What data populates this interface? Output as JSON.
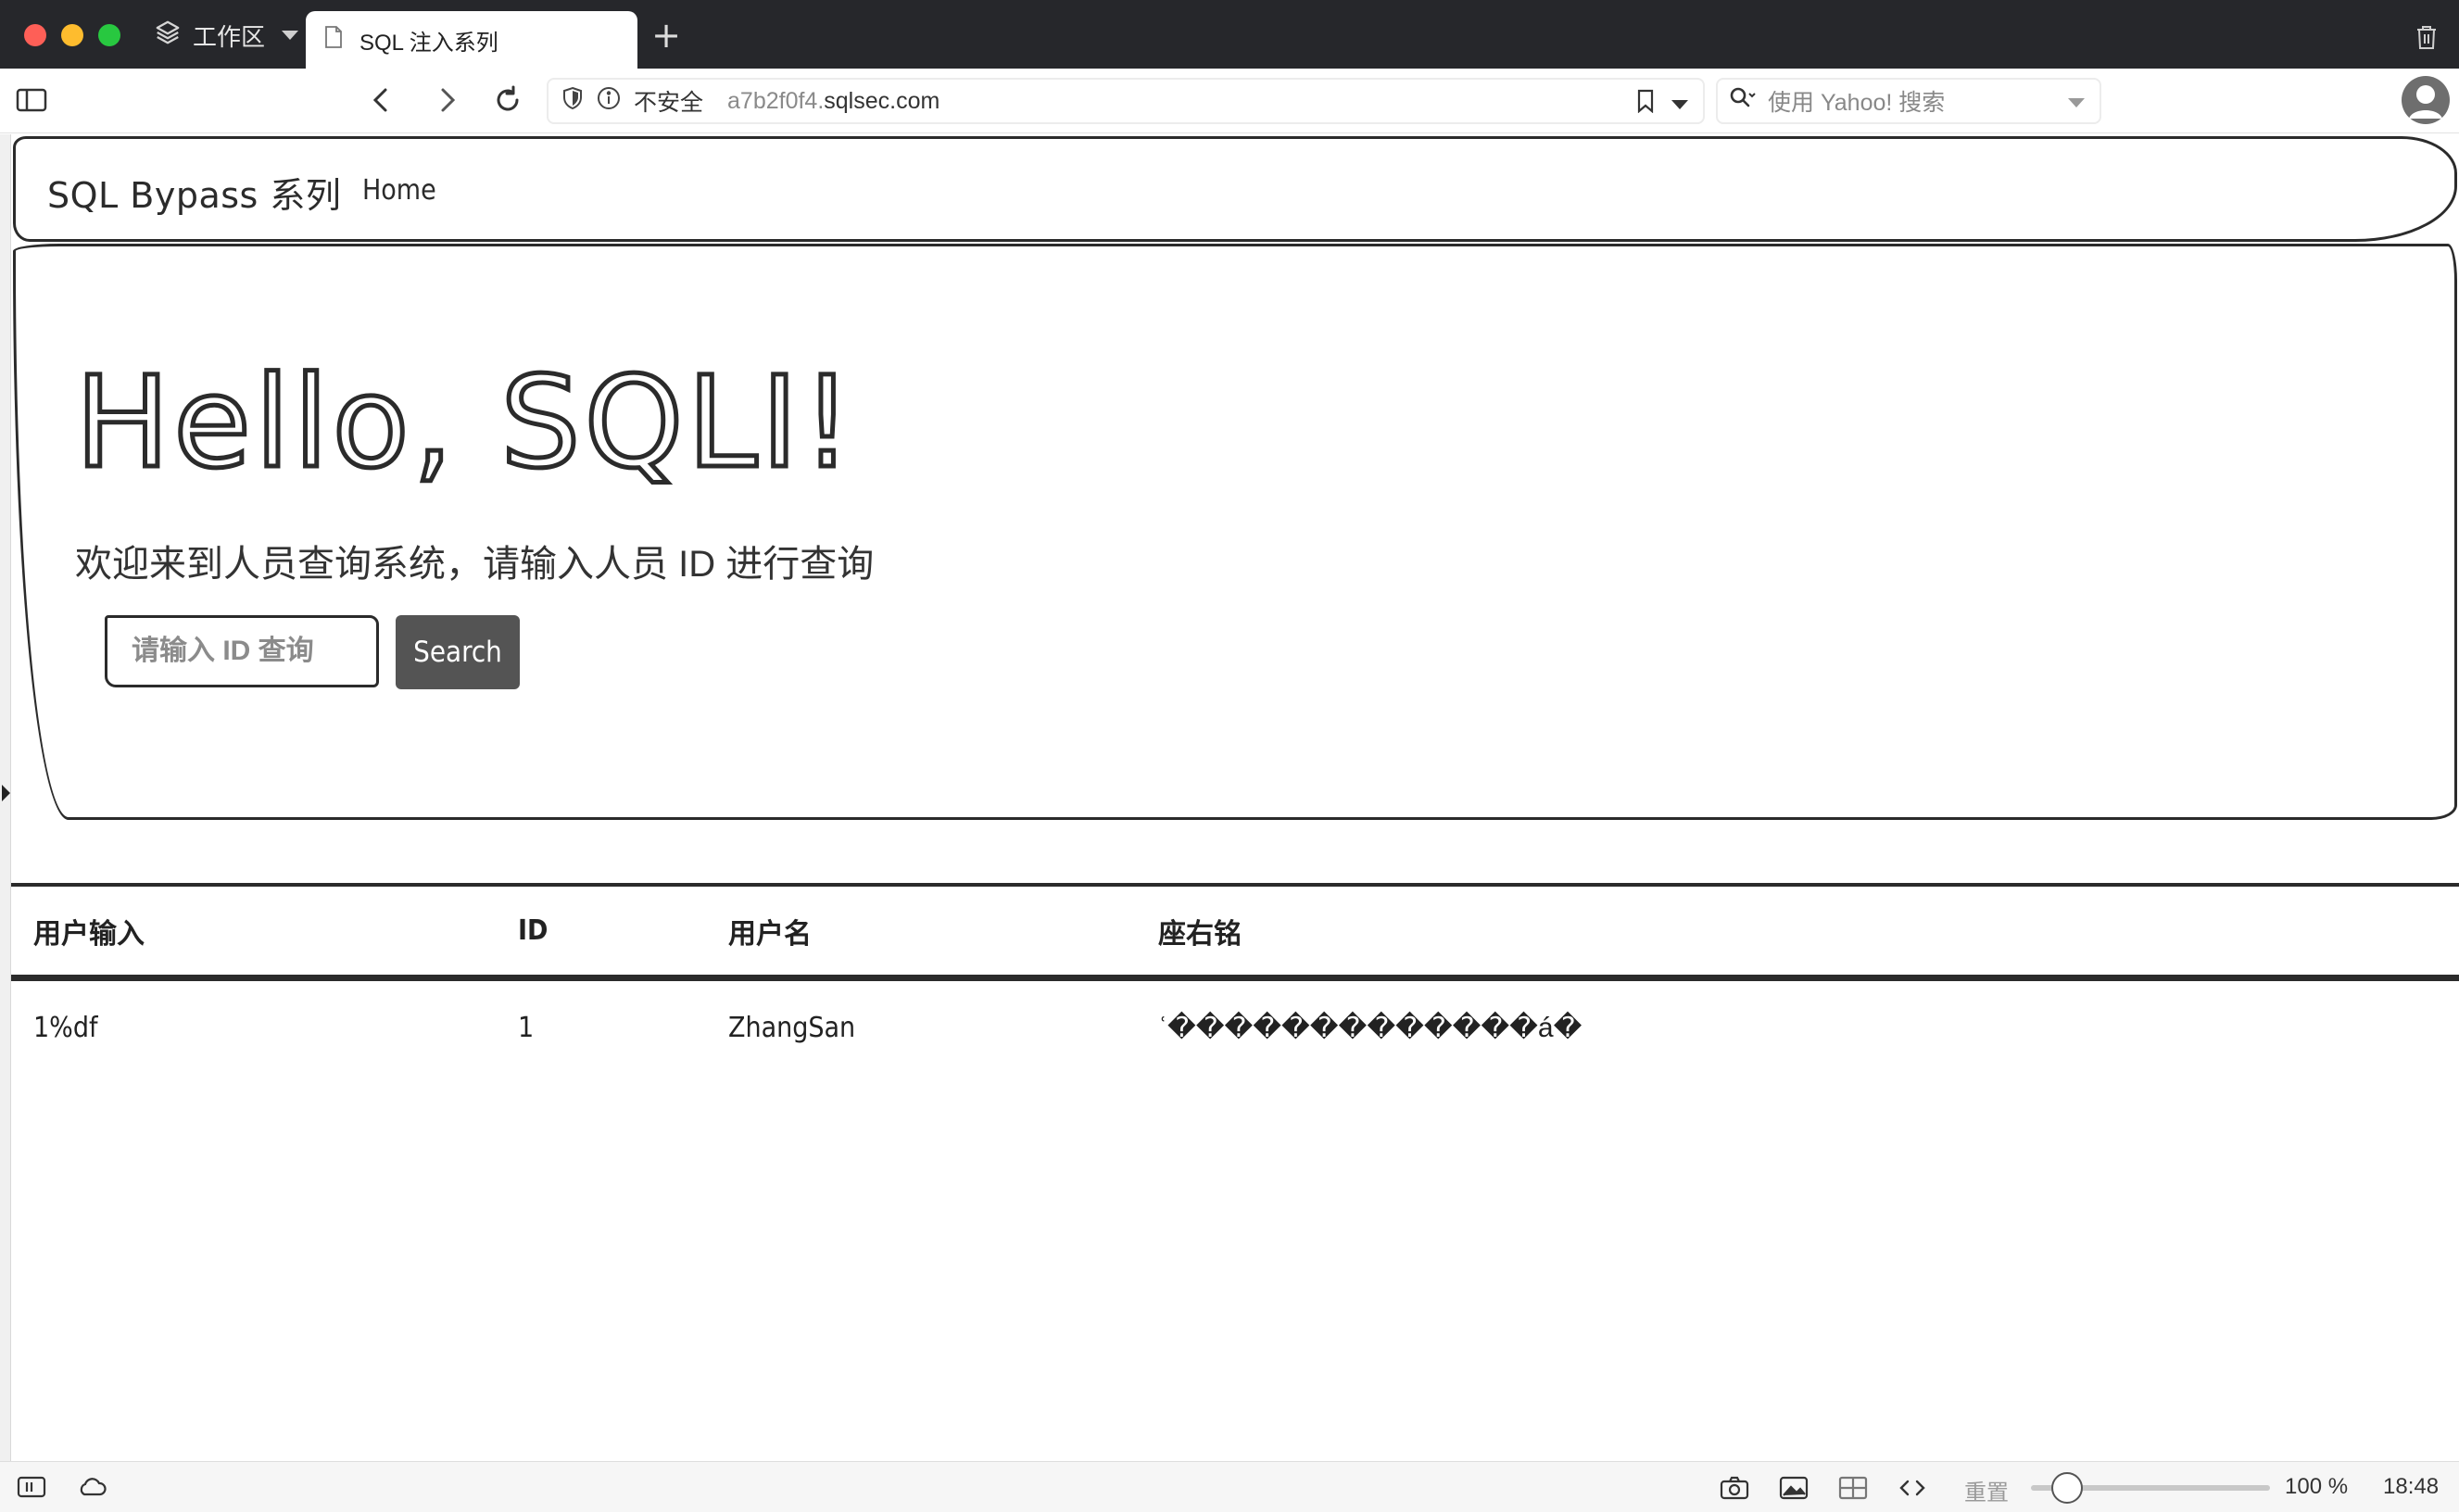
{
  "window": {
    "workspace_label": "工作区",
    "tab_title": "SQL 注入系列",
    "new_tab": "+"
  },
  "toolbar": {
    "security_label": "不安全",
    "url_subdomain": "a7b2f0f4.",
    "url_domain": "sqlsec.com",
    "search_placeholder": "使用 Yahoo! 搜索"
  },
  "site": {
    "brand": "SQL Bypass 系列",
    "nav_home": "Home",
    "heading": "Hello, SQLI!",
    "welcome": "欢迎来到人员查询系统，请输入人员 ID 进行查询",
    "input_placeholder": "请输入 ID 查询",
    "search_button": "Search"
  },
  "table": {
    "headers": [
      "用户输入",
      "ID",
      "用户名",
      "座右铭"
    ],
    "rows": [
      [
        "1%df",
        "1",
        "ZhangSan",
        "ʿ�������������á�"
      ]
    ]
  },
  "statusbar": {
    "reset_label": "重置",
    "zoom_level": 0.15,
    "zoom": "100 %",
    "time": "18:48"
  },
  "colors": {
    "titlebar": "#26272b",
    "sketch_stroke": "#2b2b2b",
    "button": "#545454"
  }
}
